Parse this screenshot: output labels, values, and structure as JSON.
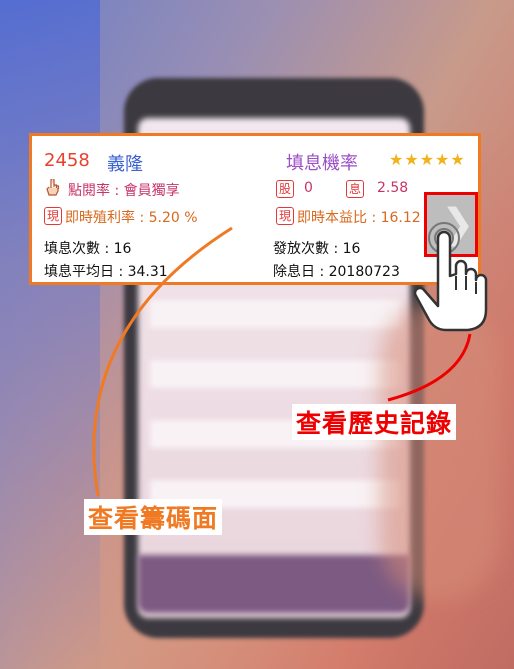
{
  "stock": {
    "code": "2458",
    "name": "義隆",
    "fill_rate_title": "填息機率",
    "stars": "★★★★★",
    "star_rating": 5,
    "clicks_label": "點閱率 : 會員獨享",
    "realtime_yield": "即時殖利率 : 5.20 %",
    "shares_badge": "股",
    "shares_value": "0",
    "dividend_badge": "息",
    "dividend_value": "2.58",
    "realtime_badge": "現",
    "realtime_pe": "即時本益比 : 16.12",
    "fill_count": "填息次數 : 16",
    "fill_avg_days": "填息平均日 :  34.31",
    "issue_count": "發放次數 : 16",
    "ex_dividend_date": "除息日 : 20180723"
  },
  "annotations": {
    "view_history": "查看歷史記錄",
    "view_chips": "查看籌碼面"
  },
  "icons": {
    "hand_point": "hand-point-icon",
    "chevron": "chevron-right-icon",
    "pointer": "pointer-hand-icon"
  },
  "colors": {
    "card_border": "#f07a24",
    "history_border": "#e00000",
    "code": "#e8412d",
    "name": "#3b63d0",
    "title": "#9b4fc6",
    "stars": "#f2b21c"
  }
}
